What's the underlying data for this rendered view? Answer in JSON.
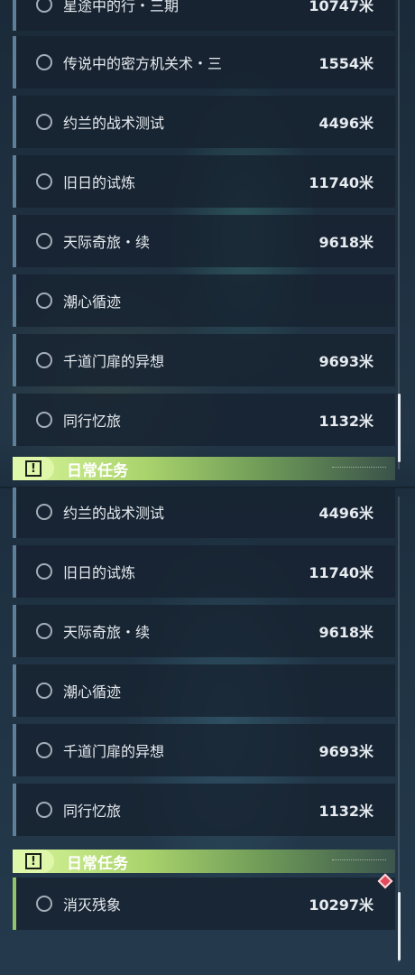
{
  "panel_a": {
    "rows": [
      {
        "name": "星途中的行・三期",
        "dist": "10747米"
      },
      {
        "name": "传说中的密方机关术・三",
        "dist": "1554米"
      },
      {
        "name": "约兰的战术测试",
        "dist": "4496米"
      },
      {
        "name": "旧日的试炼",
        "dist": "11740米"
      },
      {
        "name": "天际奇旅・续",
        "dist": "9618米"
      },
      {
        "name": "潮心循迹",
        "dist": ""
      },
      {
        "name": "千道门扉的异想",
        "dist": "9693米"
      },
      {
        "name": "同行忆旅",
        "dist": "1132米"
      }
    ],
    "section_title": "日常任务",
    "section_icon": "!"
  },
  "panel_b": {
    "rows": [
      {
        "name": "约兰的战术测试",
        "dist": "4496米"
      },
      {
        "name": "旧日的试炼",
        "dist": "11740米"
      },
      {
        "name": "天际奇旅・续",
        "dist": "9618米"
      },
      {
        "name": "潮心循迹",
        "dist": ""
      },
      {
        "name": "千道门扉的异想",
        "dist": "9693米"
      },
      {
        "name": "同行忆旅",
        "dist": "1132米"
      }
    ],
    "section_title": "日常任务",
    "section_icon": "!",
    "daily_rows": [
      {
        "name": "消灭残象",
        "dist": "10297米"
      }
    ]
  },
  "colors": {
    "row_accent": "#5d7f99",
    "daily_accent": "#8fc46a",
    "section_green": "#a9d36c",
    "badge_red": "#e04a5b"
  }
}
